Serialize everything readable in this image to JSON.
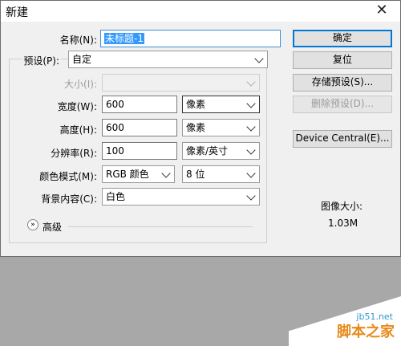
{
  "window": {
    "title": "新建",
    "close_glyph": "✕"
  },
  "form": {
    "name_label": "名称(N):",
    "name_value": "未标题-1",
    "preset_label": "预设(P):",
    "preset_value": "自定",
    "size_label": "大小(I):",
    "size_value": "",
    "width_label": "宽度(W):",
    "width_value": "600",
    "width_unit": "像素",
    "height_label": "高度(H):",
    "height_value": "600",
    "height_unit": "像素",
    "resolution_label": "分辨率(R):",
    "resolution_value": "100",
    "resolution_unit": "像素/英寸",
    "color_mode_label": "颜色模式(M):",
    "color_mode_value": "RGB 颜色",
    "bit_depth_value": "8 位",
    "background_label": "背景内容(C):",
    "background_value": "白色",
    "advanced_label": "高级",
    "advanced_icon_glyph": "»"
  },
  "buttons": {
    "ok": "确定",
    "reset": "复位",
    "save_preset": "存储预设(S)...",
    "delete_preset": "删除预设(D)...",
    "device_central": "Device Central(E)..."
  },
  "image_size": {
    "label": "图像大小:",
    "value": "1.03M"
  },
  "watermark": {
    "url": "jb51.net",
    "brand": "脚本之家"
  }
}
